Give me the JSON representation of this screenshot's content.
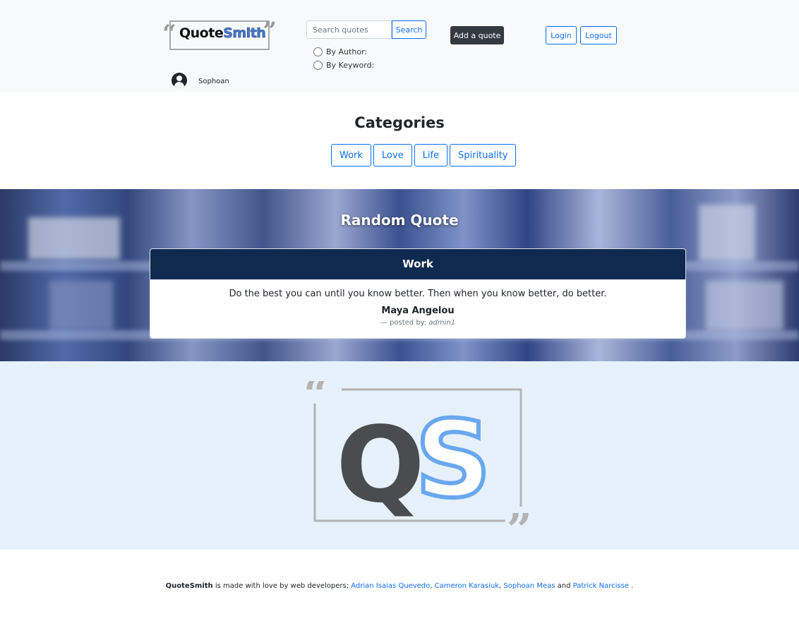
{
  "header": {
    "logo": {
      "word_dark": "Quote",
      "word_blue": "Smith"
    },
    "search": {
      "placeholder": "Search quotes",
      "button_label": "Search"
    },
    "radio_author_label": "By Author:",
    "radio_keyword_label": "By Keyword:",
    "add_quote_label": "Add a quote",
    "login_label": "Login",
    "logout_label": "Logout",
    "username": "Sophoan"
  },
  "categories": {
    "title": "Categories",
    "items": [
      "Work",
      "Love",
      "Life",
      "Spirituality"
    ]
  },
  "random_quote": {
    "title": "Random Quote",
    "category": "Work",
    "text": "Do the best you can until you know better. Then when you know better, do better.",
    "author": "Maya Angelou",
    "posted_prefix": "— posted by:",
    "posted_by": "admin1"
  },
  "big_logo": {
    "letter_q": "Q",
    "letter_s": "S"
  },
  "footer": {
    "brand": "QuoteSmith",
    "text": " is made with love by web developers; ",
    "developers": [
      "Adrian Isaias Quevedo",
      "Cameron Karasiuk",
      "Sophoan Meas",
      "Patrick Narcisse"
    ],
    "sep1": ", ",
    "sep2": ", ",
    "and": " and ",
    "end": " ."
  },
  "colors": {
    "primary": "#0d6efd",
    "dark_button": "#343a40",
    "card_header": "#10294f",
    "logo_section_bg": "#e7f1fb",
    "logo_q": "#4a4d50",
    "logo_s": "#6aa8ee"
  }
}
